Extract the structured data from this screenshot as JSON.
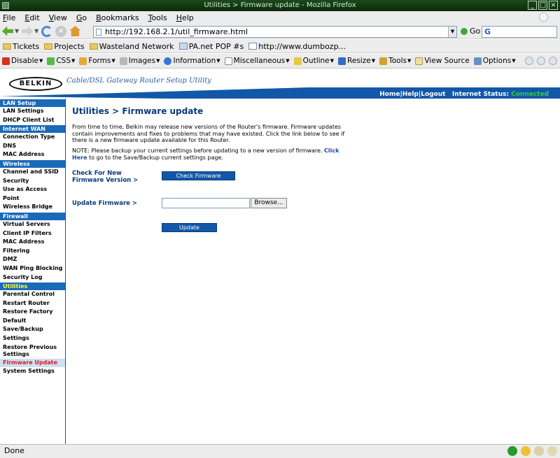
{
  "window": {
    "title": "Utilities > Firmware update - Mozilla Firefox"
  },
  "menubar": {
    "items": [
      {
        "pre": "",
        "u": "F",
        "post": "ile"
      },
      {
        "pre": "",
        "u": "E",
        "post": "dit"
      },
      {
        "pre": "",
        "u": "V",
        "post": "iew"
      },
      {
        "pre": "",
        "u": "G",
        "post": "o"
      },
      {
        "pre": "",
        "u": "B",
        "post": "ookmarks"
      },
      {
        "pre": "",
        "u": "T",
        "post": "ools"
      },
      {
        "pre": "",
        "u": "H",
        "post": "elp"
      }
    ]
  },
  "navbar": {
    "url": "http://192.168.2.1/util_firmware.html",
    "go_label": "Go",
    "search_value": "G"
  },
  "bookmarks": {
    "items": [
      "Tickets",
      "Projects",
      "Wasteland Network",
      "PA.net POP #s",
      "http://www.dumbozp..."
    ]
  },
  "webdev": {
    "items": [
      "Disable",
      "CSS",
      "Forms",
      "Images",
      "Information",
      "Miscellaneous",
      "Outline",
      "Resize",
      "Tools",
      "View Source",
      "Options"
    ]
  },
  "colors": {
    "accent": "#1258a8",
    "connected": "#33cc44",
    "active_item": "#e01818"
  },
  "router": {
    "logo": "BELKIN",
    "tagline": "Cable/DSL Gateway Router Setup Utility",
    "toplinks": {
      "home": "Home",
      "help": "Help",
      "logout": "Logout",
      "status_label": "Internet Status:",
      "status_value": "Connected"
    }
  },
  "sidebar": {
    "lan_setup": "LAN Setup",
    "lan_settings": "LAN Settings",
    "dhcp_client_list": "DHCP Client List",
    "internet_wan": "Internet WAN",
    "connection_type": "Connection Type",
    "dns": "DNS",
    "mac_address": "MAC Address",
    "wireless": "Wireless",
    "channel_ssid": "Channel and SSID",
    "security": "Security",
    "access_point": "Use as Access Point",
    "wireless_bridge": "Wireless Bridge",
    "firewall": "Firewall",
    "virtual_servers": "Virtual Servers",
    "client_ip_filters": "Client IP Filters",
    "mac_filtering": "MAC Address Filtering",
    "dmz": "DMZ",
    "wan_ping": "WAN Ping Blocking",
    "security_log": "Security Log",
    "utilities": "Utilities",
    "parental_control": "Parental Control",
    "restart_router": "Restart Router",
    "restore_factory": "Restore Factory Default",
    "save_backup": "Save/Backup Settings",
    "restore_previous": "Restore Previous Settings",
    "firmware_update": "Firmware Update",
    "system_settings": "System Settings"
  },
  "main": {
    "title": "Utilities > Firmware update",
    "description": "From time to time, Belkin may release new versions of the Router's firmware. Firmware updates contain improvements and fixes to problems that may have existed. Click the link below to see if there is a new firmware update available for this Router.",
    "note_prefix": "NOTE: Please backup your current settings before updating to a new version of firmware. ",
    "note_link": "Click Here",
    "note_suffix": " to go to the Save/Backup current settings page.",
    "check_label": "Check For New Firmware Version >",
    "check_button": "Check Firmware",
    "update_label": "Update Firmware >",
    "browse_button": "Browse...",
    "update_button": "Update"
  },
  "statusbar": {
    "text": "Done"
  }
}
